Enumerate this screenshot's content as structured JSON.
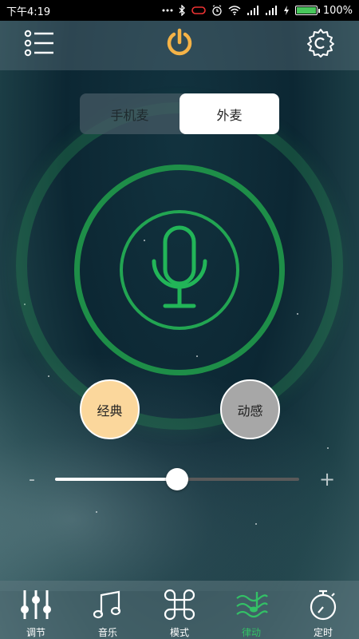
{
  "status_bar": {
    "time": "下午4:19",
    "battery": "100%",
    "battery_level": 1.0
  },
  "toolbar": {
    "menu_icon": "list-menu-icon",
    "power_icon": "power-icon",
    "settings_icon": "gear-icon"
  },
  "mic_mode": {
    "options": [
      "手机麦",
      "外麦"
    ],
    "selected": "外麦"
  },
  "mic_icon": "microphone-icon",
  "style_buttons": {
    "classic": "经典",
    "dynamic": "动感"
  },
  "slider": {
    "minus": "-",
    "plus": "+",
    "value": 0.5
  },
  "tabs": [
    {
      "label": "调节",
      "icon": "equalizer-sliders-icon"
    },
    {
      "label": "音乐",
      "icon": "music-note-icon"
    },
    {
      "label": "模式",
      "icon": "command-icon"
    },
    {
      "label": "律动",
      "icon": "rhythm-wave-icon",
      "active": true
    },
    {
      "label": "定时",
      "icon": "stopwatch-icon"
    }
  ],
  "colors": {
    "accent": "#33c166",
    "power": "#f5b347",
    "classic": "#fbd79c",
    "dynamic": "#a7a7a7"
  }
}
